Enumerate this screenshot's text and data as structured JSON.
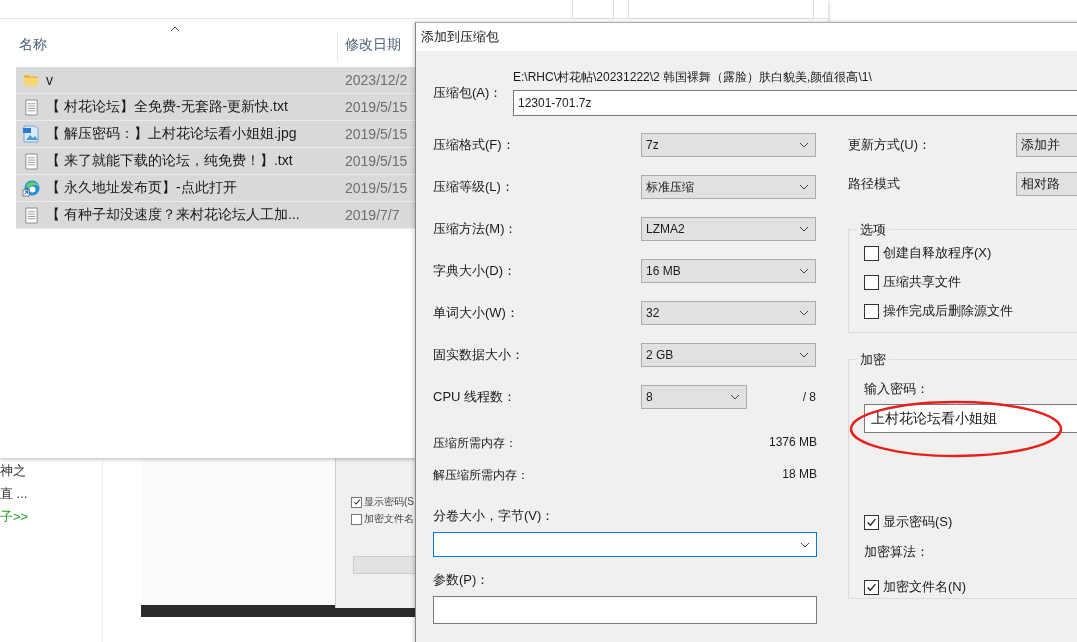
{
  "background_page": {
    "texts": [
      {
        "text": "神之",
        "kind": "plain"
      },
      {
        "text": "直 ...",
        "kind": "plain"
      },
      {
        "text": "子>>",
        "kind": "link"
      }
    ]
  },
  "background_dialog": {
    "checkboxes": [
      {
        "label": "显示密码(S",
        "checked": true
      },
      {
        "label": "加密文件名",
        "checked": false
      }
    ]
  },
  "explorer": {
    "columns": [
      "名称",
      "修改日期"
    ],
    "rows": [
      {
        "name": "v",
        "date": "2023/12/2",
        "kind": "folder",
        "selected": true
      },
      {
        "name": "【 村花论坛】全免费-无套路-更新快.txt",
        "date": "2019/5/15",
        "kind": "text",
        "selected": true
      },
      {
        "name": "【 解压密码：】上村花论坛看小姐姐.jpg",
        "date": "2019/5/15",
        "kind": "image",
        "selected": true
      },
      {
        "name": "【 来了就能下载的论坛，纯免费！】.txt",
        "date": "2019/5/15",
        "kind": "text",
        "selected": true
      },
      {
        "name": "【 永久地址发布页】-点此打开",
        "date": "2019/5/15",
        "kind": "shortcut",
        "selected": true
      },
      {
        "name": "【 有种子却没速度？来村花论坛人工加...",
        "date": "2019/7/7",
        "kind": "text",
        "selected": true
      }
    ]
  },
  "dialog": {
    "title": "添加到压缩包",
    "archive": {
      "label": "压缩包(A)：",
      "path": "E:\\RHC\\村花帖\\20231222\\2 韩国裸舞（露脸）肤白貌美,颜值很高\\1\\",
      "value": "12301-701.7z"
    },
    "settings": [
      {
        "label": "压缩格式(F)：",
        "value": "7z"
      },
      {
        "label": "压缩等级(L)：",
        "value": "标准压缩"
      },
      {
        "label": "压缩方法(M)：",
        "value": "LZMA2"
      },
      {
        "label": "字典大小(D)：",
        "value": "16 MB"
      },
      {
        "label": "单词大小(W)：",
        "value": "32"
      },
      {
        "label": "固实数据大小：",
        "value": "2 GB"
      },
      {
        "label": "CPU 线程数：",
        "value": "8",
        "suffix": "/ 8"
      }
    ],
    "memory": [
      {
        "label": "压缩所需内存：",
        "value": "1376 MB"
      },
      {
        "label": "解压缩所需内存：",
        "value": "18 MB"
      }
    ],
    "volume": {
      "label": "分卷大小，字节(V)："
    },
    "parameters": {
      "label": "参数(P)："
    },
    "update_mode": {
      "label": "更新方式(U)：",
      "value": "添加并"
    },
    "path_mode": {
      "label": "路径模式",
      "value": "相对路"
    },
    "options": {
      "title": "选项",
      "checkboxes": [
        {
          "label": "创建自释放程序(X)",
          "checked": false
        },
        {
          "label": "压缩共享文件",
          "checked": false
        },
        {
          "label": "操作完成后删除源文件",
          "checked": false
        }
      ]
    },
    "encryption": {
      "title": "加密",
      "password_label": "输入密码：",
      "password": "上村花论坛看小姐姐",
      "show_password": {
        "label": "显示密码(S)",
        "checked": true
      },
      "method_label": "加密算法：",
      "encrypt_names": {
        "label": "加密文件名(N)",
        "checked": true
      }
    }
  }
}
